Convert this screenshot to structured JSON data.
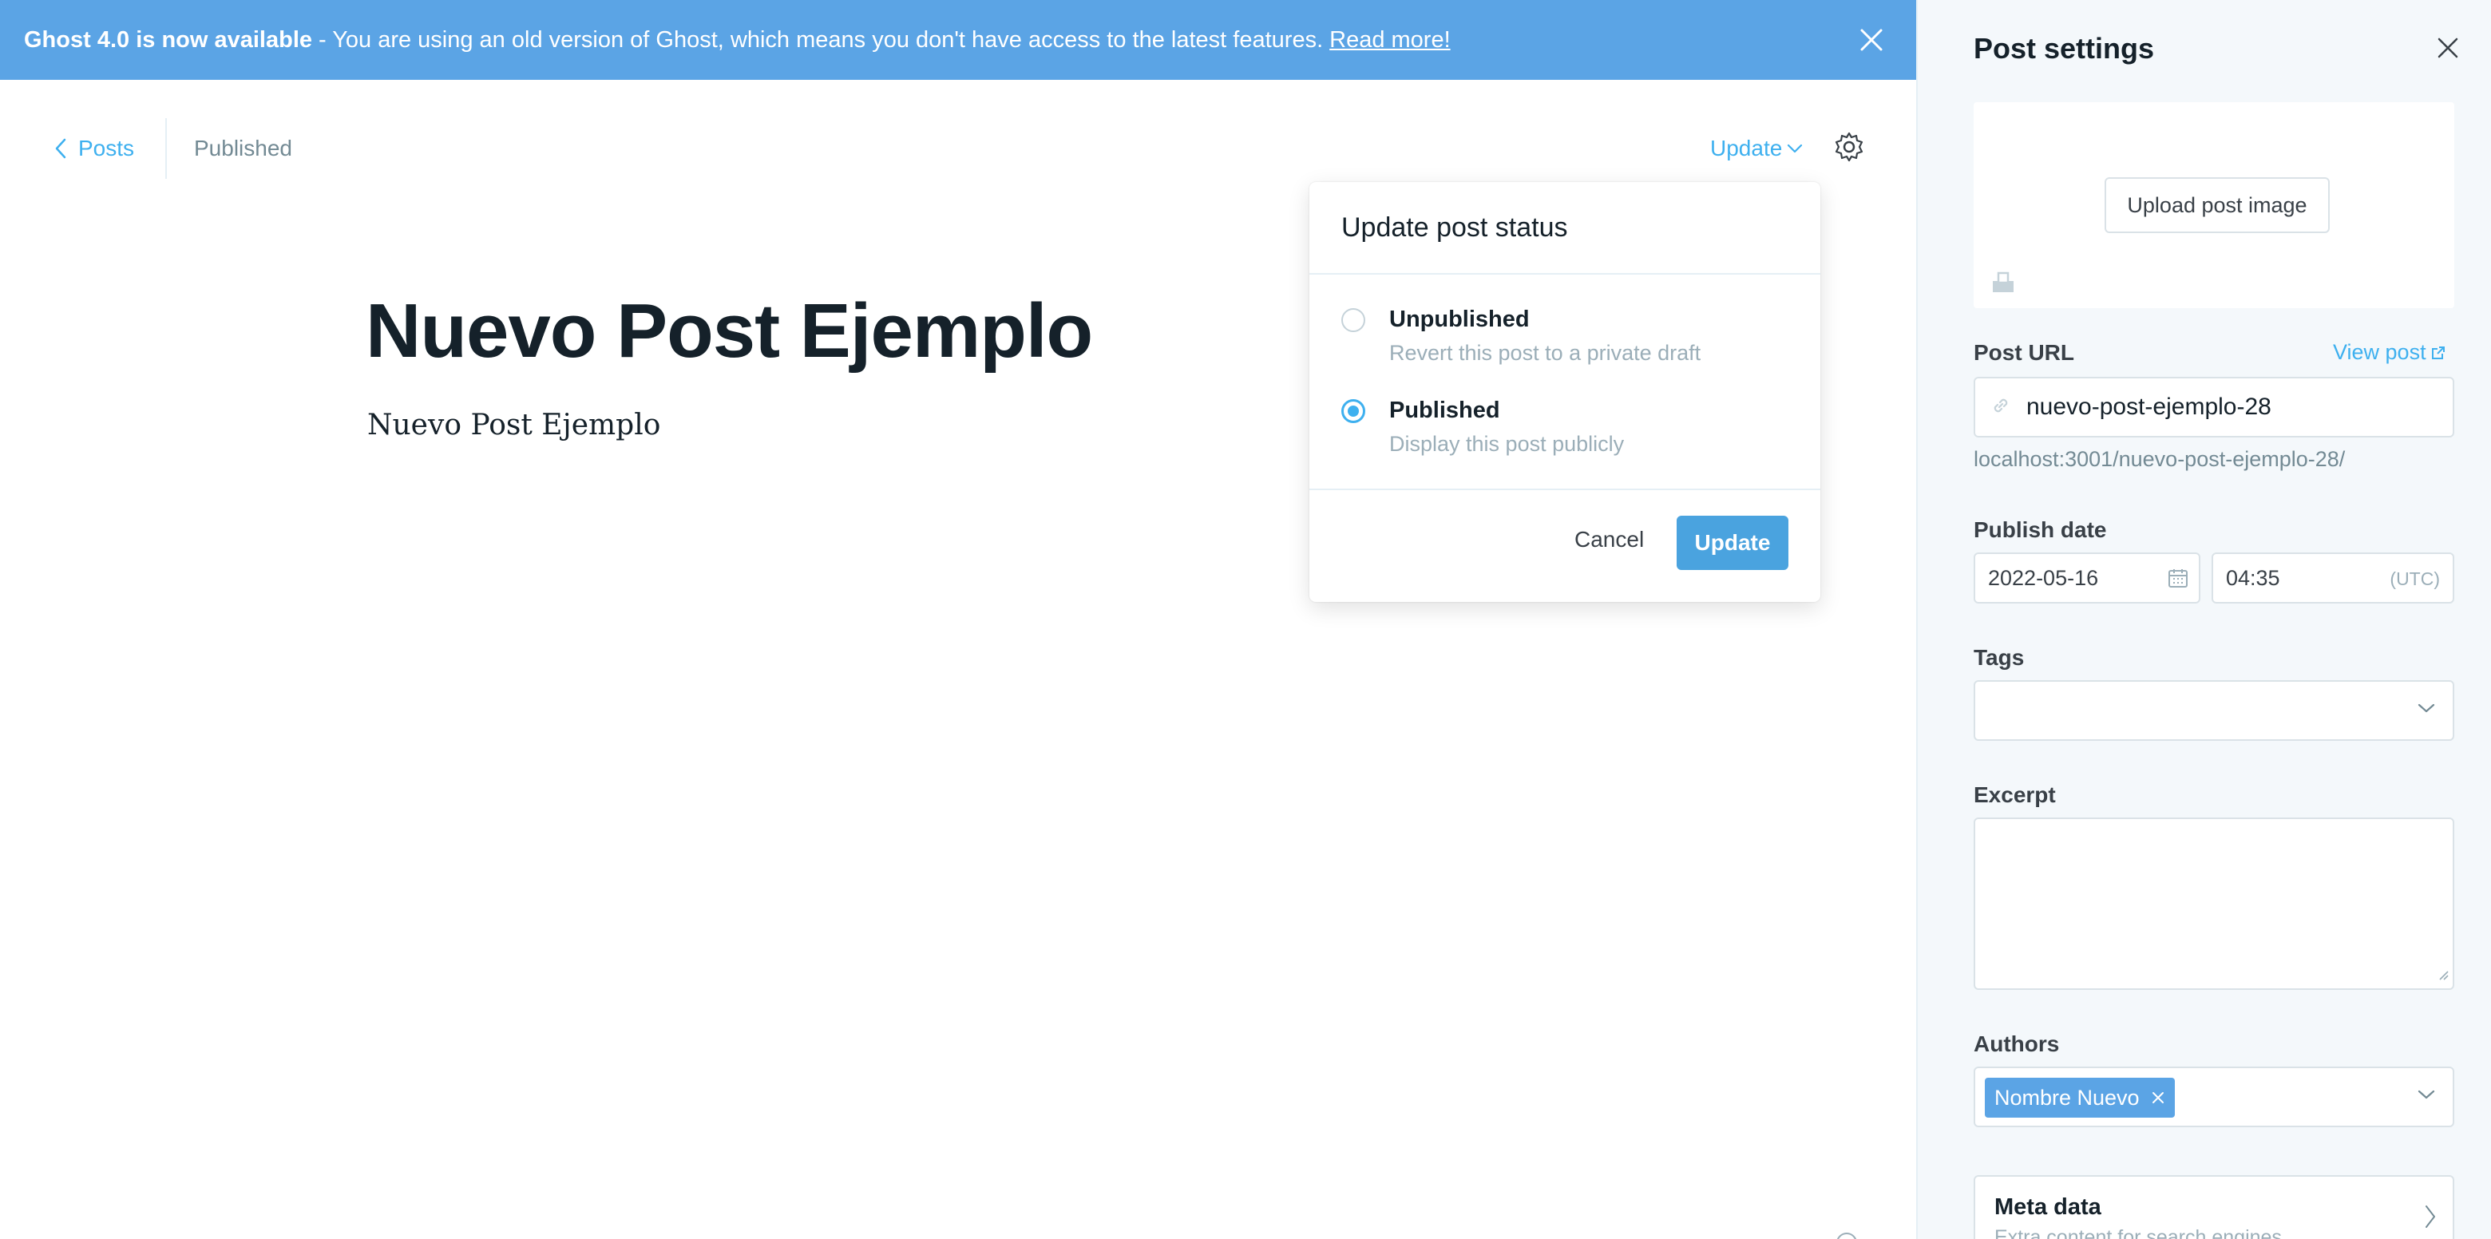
{
  "banner": {
    "bold": "Ghost 4.0 is now available",
    "message": "- You are using an old version of Ghost, which means you don't have access to the latest features.",
    "link": "Read more!",
    "color": "#5ba4e5"
  },
  "nav": {
    "back_label": "Posts",
    "status": "Published",
    "update_label": "Update"
  },
  "post": {
    "title": "Nuevo Post Ejemplo",
    "body": "Nuevo Post Ejemplo"
  },
  "status_menu": {
    "title": "Update post status",
    "options": [
      {
        "label": "Unpublished",
        "description": "Revert this post to a private draft",
        "selected": false
      },
      {
        "label": "Published",
        "description": "Display this post publicly",
        "selected": true
      }
    ],
    "cancel": "Cancel",
    "update": "Update"
  },
  "settings": {
    "title": "Post settings",
    "upload_image": "Upload post image",
    "url_label": "Post URL",
    "view_post": "View post",
    "slug": "nuevo-post-ejemplo-28",
    "full_url": "localhost:3001/nuevo-post-ejemplo-28/",
    "publish_date_label": "Publish date",
    "date": "2022-05-16",
    "time": "04:35",
    "timezone": "(UTC)",
    "tags_label": "Tags",
    "excerpt_label": "Excerpt",
    "authors_label": "Authors",
    "author": "Nombre Nuevo",
    "meta_title": "Meta data",
    "meta_desc": "Extra content for search engines"
  },
  "colors": {
    "accent": "#3eb0ef",
    "button": "#4aa3df"
  }
}
